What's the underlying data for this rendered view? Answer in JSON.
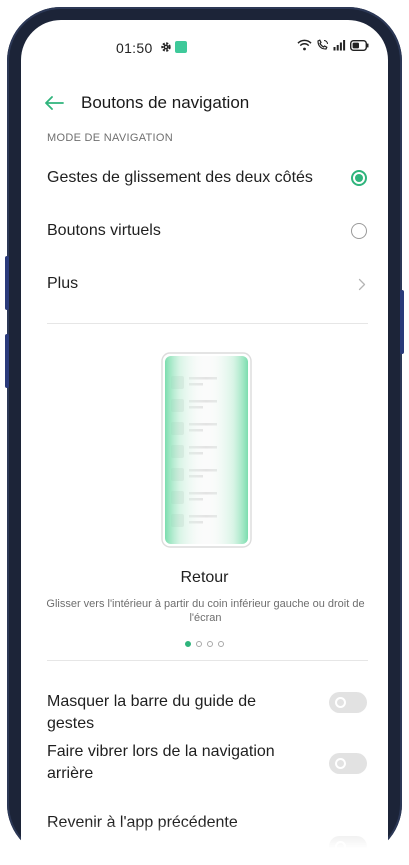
{
  "status_bar": {
    "time": "01:50",
    "icons": [
      "gear-icon",
      "notification-icon",
      "wifi-icon",
      "call-icon",
      "signal-icon",
      "battery-icon"
    ]
  },
  "header": {
    "back_icon": "arrow-left-icon",
    "title": "Boutons de navigation"
  },
  "navigation_mode": {
    "section_label": "MODE DE NAVIGATION",
    "options": [
      {
        "label": "Gestes de glissement des deux côtés",
        "selected": true
      },
      {
        "label": "Boutons virtuels",
        "selected": false
      }
    ],
    "more_label": "Plus"
  },
  "gesture_demo": {
    "title": "Retour",
    "description": "Glisser vers l'intérieur à partir du coin inférieur gauche ou droit de l'écran",
    "page_count": 4,
    "active_page": 1
  },
  "settings": [
    {
      "label": "Masquer la barre du guide de gestes",
      "enabled": false
    },
    {
      "label": "Faire vibrer lors de la navigation arrière",
      "enabled": false
    },
    {
      "label": "Revenir à l'app précédente",
      "enabled": false
    }
  ],
  "colors": {
    "accent": "#2fb47c",
    "text_primary": "#1f1f1f",
    "text_secondary": "#6e6e6e",
    "divider": "#e6e6e6",
    "toggle_off": "#e2e2e2",
    "device_frame": "#1c2438"
  }
}
